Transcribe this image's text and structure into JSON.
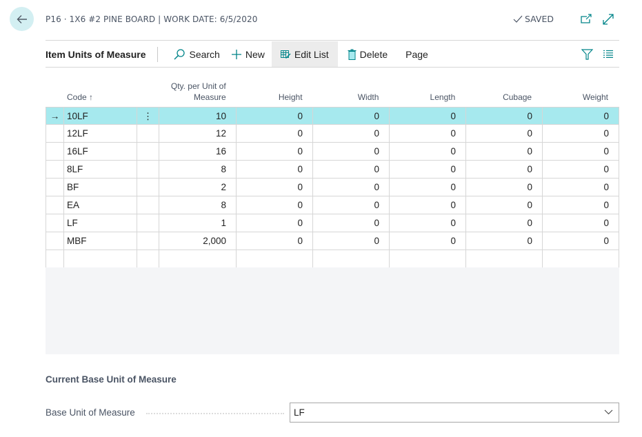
{
  "header": {
    "title": "P16 · 1X6 #2 PINE BOARD | WORK DATE: 6/5/2020",
    "status": "SAVED",
    "icons": [
      "back-arrow-icon",
      "checkmark-icon",
      "open-new-window-icon",
      "expand-icon"
    ]
  },
  "actionbar": {
    "title": "Item Units of Measure",
    "buttons": [
      {
        "label": "Search",
        "icon": "search-icon"
      },
      {
        "label": "New",
        "icon": "plus-icon"
      },
      {
        "label": "Edit List",
        "icon": "edit-list-icon",
        "active": true
      },
      {
        "label": "Delete",
        "icon": "delete-icon"
      },
      {
        "label": "Page"
      }
    ],
    "right_icons": [
      "filter-icon",
      "list-view-icon"
    ]
  },
  "grid": {
    "columns": [
      {
        "label": "Code ↑",
        "key": "code"
      },
      {
        "label": "Qty. per Unit of Measure",
        "line1": "Qty. per Unit of",
        "line2": "Measure",
        "key": "qty"
      },
      {
        "label": "Height",
        "key": "height"
      },
      {
        "label": "Width",
        "key": "width"
      },
      {
        "label": "Length",
        "key": "length"
      },
      {
        "label": "Cubage",
        "key": "cubage"
      },
      {
        "label": "Weight",
        "key": "weight"
      }
    ],
    "rows": [
      {
        "code": "10LF",
        "qty": "10",
        "height": "0",
        "width": "0",
        "length": "0",
        "cubage": "0",
        "weight": "0",
        "selected": true
      },
      {
        "code": "12LF",
        "qty": "12",
        "height": "0",
        "width": "0",
        "length": "0",
        "cubage": "0",
        "weight": "0"
      },
      {
        "code": "16LF",
        "qty": "16",
        "height": "0",
        "width": "0",
        "length": "0",
        "cubage": "0",
        "weight": "0"
      },
      {
        "code": "8LF",
        "qty": "8",
        "height": "0",
        "width": "0",
        "length": "0",
        "cubage": "0",
        "weight": "0"
      },
      {
        "code": "BF",
        "qty": "2",
        "height": "0",
        "width": "0",
        "length": "0",
        "cubage": "0",
        "weight": "0"
      },
      {
        "code": "EA",
        "qty": "8",
        "height": "0",
        "width": "0",
        "length": "0",
        "cubage": "0",
        "weight": "0"
      },
      {
        "code": "LF",
        "qty": "1",
        "height": "0",
        "width": "0",
        "length": "0",
        "cubage": "0",
        "weight": "0"
      },
      {
        "code": "MBF",
        "qty": "2,000",
        "height": "0",
        "width": "0",
        "length": "0",
        "cubage": "0",
        "weight": "0"
      },
      {
        "code": "",
        "qty": "",
        "height": "",
        "width": "",
        "length": "",
        "cubage": "",
        "weight": ""
      }
    ],
    "selected_indicator": "→",
    "row_menu": "⋮"
  },
  "footer": {
    "section_title": "Current Base Unit of Measure",
    "field_label": "Base Unit of Measure",
    "field_value": "LF"
  },
  "colors": {
    "accent": "#008489",
    "selected_row": "#a6e9ee",
    "back_button_bg": "#d3eff2",
    "empty_area": "#f4f5f7"
  }
}
